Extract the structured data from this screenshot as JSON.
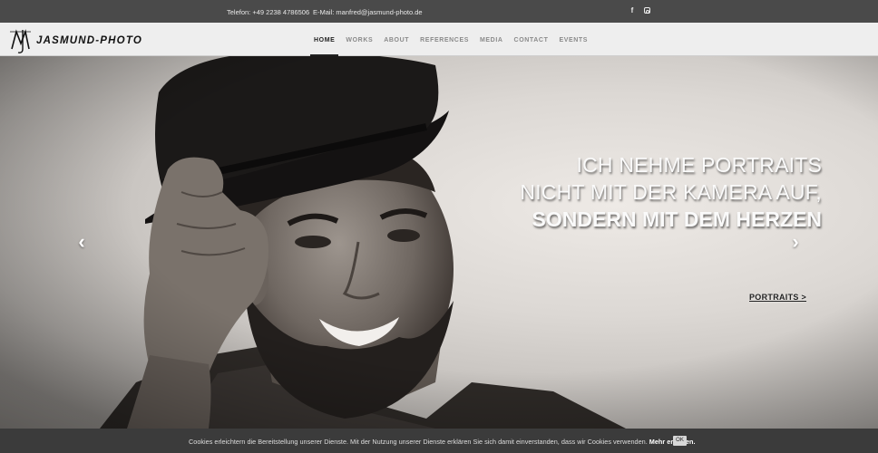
{
  "topbar": {
    "phone": "Telefon: +49 2238 4786506",
    "email": "E-Mail: manfred@jasmund-photo.de",
    "social": [
      {
        "icon": "facebook-icon",
        "glyph": "f"
      },
      {
        "icon": "instagram-icon"
      }
    ]
  },
  "header": {
    "logo_text": "JASMUND-PHOTO"
  },
  "nav": {
    "items": [
      {
        "label": "HOME",
        "active": true
      },
      {
        "label": "WORKS",
        "active": false
      },
      {
        "label": "ABOUT",
        "active": false
      },
      {
        "label": "REFERENCES",
        "active": false
      },
      {
        "label": "MEDIA",
        "active": false
      },
      {
        "label": "CONTACT",
        "active": false
      },
      {
        "label": "EVENTS",
        "active": false
      }
    ]
  },
  "hero": {
    "line1": "ICH NEHME PORTRAITS",
    "line2": "NICHT MIT DER KAMERA AUF,",
    "line3": "SONDERN MIT DEM HERZEN",
    "link": "PORTRAITS >",
    "prev_glyph": "‹",
    "next_glyph": "›"
  },
  "cookie": {
    "text": "Cookies erleichtern die Bereitstellung unserer Dienste. Mit der Nutzung unserer Dienste erklären Sie sich damit einverstanden, dass wir Cookies verwenden.",
    "more": "Mehr erfahren.",
    "ok": "OK"
  }
}
